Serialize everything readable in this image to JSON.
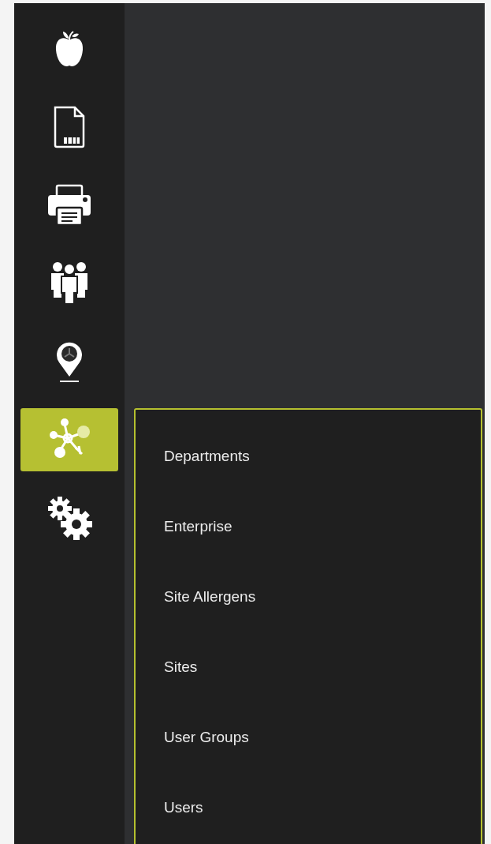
{
  "sidebar": {
    "items": [
      {
        "selected": false
      },
      {
        "selected": false
      },
      {
        "selected": false
      },
      {
        "selected": false
      },
      {
        "selected": false
      },
      {
        "selected": true
      },
      {
        "selected": false
      }
    ]
  },
  "menu": {
    "items": [
      {
        "label": "Departments"
      },
      {
        "label": "Enterprise"
      },
      {
        "label": "Site Allergens"
      },
      {
        "label": "Sites"
      },
      {
        "label": "User Groups"
      },
      {
        "label": "Users"
      }
    ]
  }
}
